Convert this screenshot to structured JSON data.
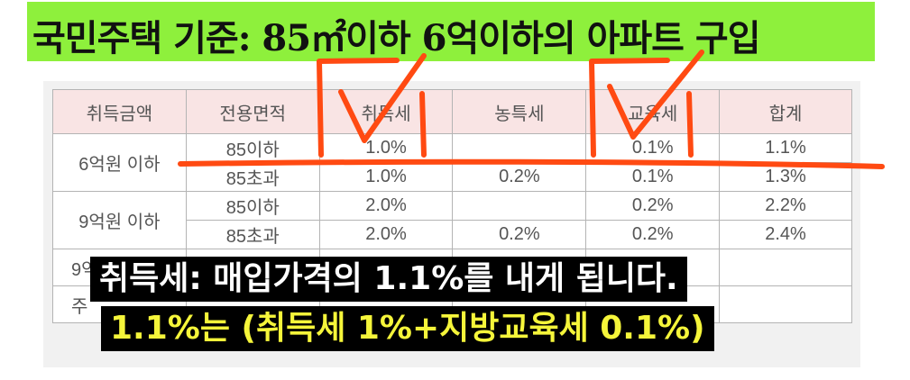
{
  "title": "국민주택 기준: 85㎡이하 6억이하의 아파트 구입",
  "table": {
    "headers": [
      "취득금액",
      "전용면적",
      "취득세",
      "농특세",
      "교육세",
      "합계"
    ],
    "groups": [
      {
        "amount": "6억원 이하",
        "rows": [
          {
            "area": "85이하",
            "acq": "1.0%",
            "rural": "",
            "edu": "0.1%",
            "total": "1.1%"
          },
          {
            "area": "85초과",
            "acq": "1.0%",
            "rural": "0.2%",
            "edu": "0.1%",
            "total": "1.3%"
          }
        ]
      },
      {
        "amount": "9억원 이하",
        "rows": [
          {
            "area": "85이하",
            "acq": "2.0%",
            "rural": "",
            "edu": "0.2%",
            "total": "2.2%"
          },
          {
            "area": "85초과",
            "acq": "2.0%",
            "rural": "0.2%",
            "edu": "0.2%",
            "total": "2.4%"
          }
        ]
      }
    ],
    "partial_left_1": "9억",
    "partial_left_2": "주"
  },
  "captions": {
    "line1": "취득세: 매입가격의 1.1%를 내게 됩니다.",
    "line2": "1.1%는 (취득세 1%+지방교육세 0.1%)"
  },
  "colors": {
    "title_bg": "#8ef03c",
    "header_bg": "#f9e4e4",
    "annotation": "#ff4a12",
    "caption_line2": "#f5f53a"
  }
}
